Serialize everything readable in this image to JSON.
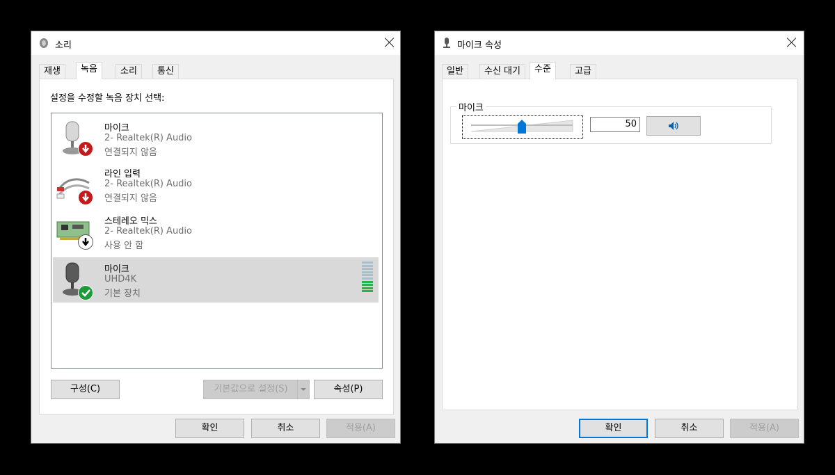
{
  "sound_dialog": {
    "title": "소리",
    "tabs": [
      "재생",
      "녹음",
      "소리",
      "통신"
    ],
    "active_tab": "녹음",
    "instruction": "설정을 수정할 녹음 장치 선택:",
    "devices": [
      {
        "name": "마이크",
        "driver": "2- Realtek(R) Audio",
        "status": "연결되지 않음",
        "badge": "red-down-arrow",
        "icon": "microphone-icon"
      },
      {
        "name": "라인 입력",
        "driver": "2- Realtek(R) Audio",
        "status": "연결되지 않음",
        "badge": "red-down-arrow",
        "icon": "rca-cable-icon"
      },
      {
        "name": "스테레오 믹스",
        "driver": "2- Realtek(R) Audio",
        "status": "사용 안 함",
        "badge": "black-down-arrow",
        "icon": "sound-card-icon"
      },
      {
        "name": "마이크",
        "driver": "UHD4K",
        "status": "기본 장치",
        "badge": "green-check",
        "icon": "microphone-icon",
        "selected": true,
        "level_meter_bars_lit": 4,
        "level_meter_bars_total": 10
      }
    ],
    "configure_button": "구성(C)",
    "set_default_button": "기본값으로 설정(S)",
    "properties_button": "속성(P)",
    "ok_button": "확인",
    "cancel_button": "취소",
    "apply_button": "적용(A)"
  },
  "mic_properties": {
    "title": "마이크 속성",
    "tabs": [
      "일반",
      "수신 대기",
      "수준",
      "고급"
    ],
    "active_tab": "수준",
    "group_label": "마이크",
    "level_value": "50",
    "slider_fraction": 0.5,
    "ok_button": "확인",
    "cancel_button": "취소",
    "apply_button": "적용(A)"
  },
  "colors": {
    "selected_row": "#d9d9d9",
    "accent": "#0078d7",
    "meter_green": "#2bb14a",
    "meter_off": "#a8bfcc"
  }
}
